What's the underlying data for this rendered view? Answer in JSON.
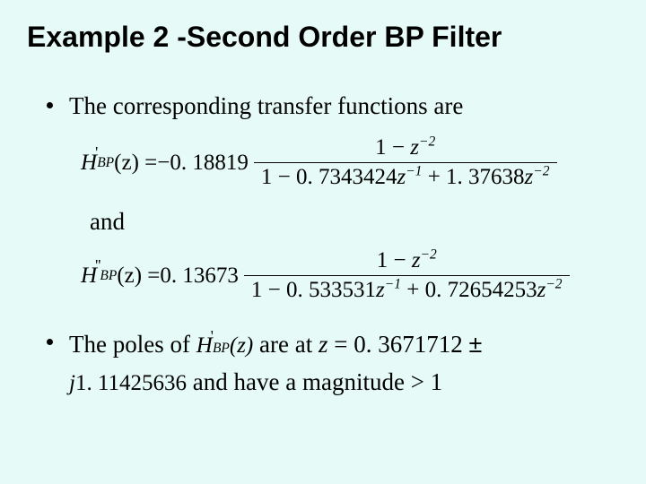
{
  "title": "Example 2 -Second Order BP Filter",
  "bullets": {
    "b1": "The corresponding transfer functions are",
    "and": "and",
    "b2_pre": "The poles of ",
    "b2_mid": " are at ",
    "b2_eq_lead": "z = ",
    "b2_val": "0. 3671712 ",
    "b2_jline_pre": "j",
    "b2_jline_val": "1. 11425636",
    "b2_tail": "  and have a magnitude > 1"
  },
  "eq1": {
    "func_sym": "H",
    "sub": "BP",
    "prime": "'",
    "arg": "(z) = ",
    "coef": "−0. 18819",
    "num_a": "1 − ",
    "num_b": "z",
    "num_exp": "−2",
    "den_a": "1 − 0. 7343424",
    "den_b": "z",
    "den_exp1": "−1",
    "den_c": " + 1. 37638",
    "den_d": "z",
    "den_exp2": "−2"
  },
  "eq2": {
    "func_sym": "H",
    "sub": "BP",
    "prime": "''",
    "arg": "(z) = ",
    "coef": "0. 13673",
    "num_a": "1 − ",
    "num_b": "z",
    "num_exp": "−2",
    "den_a": "1 − 0. 533531",
    "den_b": "z",
    "den_exp1": "−1",
    "den_c": " + 0. 72654253",
    "den_d": "z",
    "den_exp2": "−2"
  },
  "inline_fn": {
    "sym": "H",
    "sub": "BP",
    "prime": "'",
    "arg": "(z)"
  }
}
